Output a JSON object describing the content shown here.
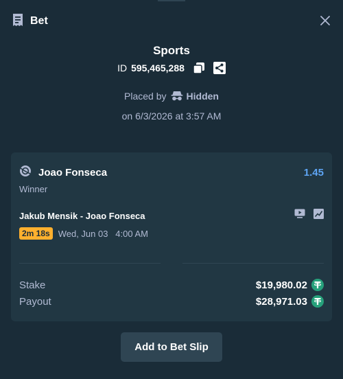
{
  "header": {
    "title": "Bet",
    "icon": "receipt-icon",
    "close_icon": "close-icon"
  },
  "bet": {
    "category": "Sports",
    "id_label": "ID",
    "id_value": "595,465,288",
    "placed_by_label": "Placed by",
    "placed_by_user": "Hidden",
    "placed_on": "on 6/3/2026 at 3:57 AM"
  },
  "selection": {
    "name": "Joao Fonseca",
    "odds": "1.45",
    "market": "Winner",
    "event": "Jakub Mensik - Joao Fonseca",
    "countdown": "2m 18s",
    "start_time": "Wed, Jun 03   4:00 AM",
    "sport_icon": "tennis-ball-icon"
  },
  "amounts": {
    "stake_label": "Stake",
    "stake_value": "$19,980.02",
    "payout_label": "Payout",
    "payout_value": "$28,971.03",
    "currency_icon": "tether-icon"
  },
  "actions": {
    "add_to_slip": "Add to Bet Slip"
  },
  "colors": {
    "background": "#1a2c38",
    "card": "#213743",
    "muted_text": "#b1bad3",
    "odds": "#5ea5f4",
    "badge": "#ffb02e",
    "tether": "#26a17b",
    "button": "#2f4553"
  }
}
